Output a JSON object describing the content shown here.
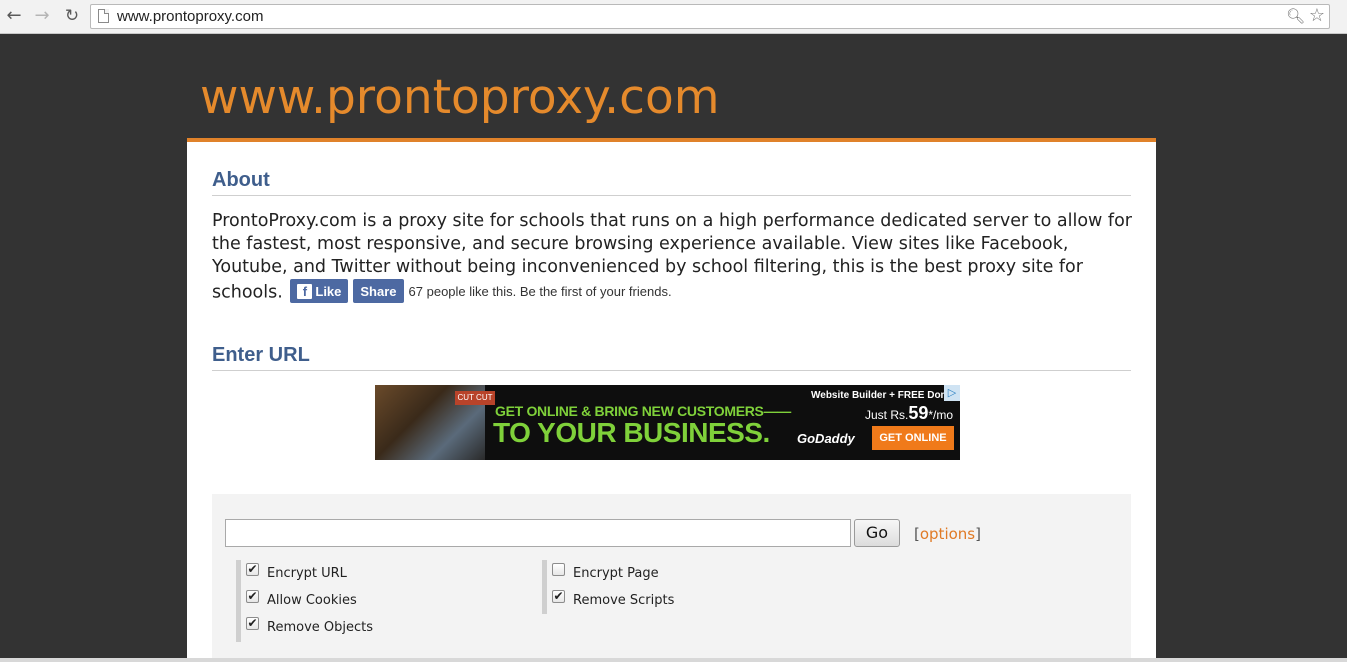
{
  "browser": {
    "back_icon": "←",
    "forward_icon": "→",
    "reload_icon": "↻",
    "address": "www.prontoproxy.com"
  },
  "site": {
    "title": "www.prontoproxy.com",
    "accent_color": "#e58a2c"
  },
  "about": {
    "heading": "About",
    "text": "ProntoProxy.com is a proxy site for schools that runs on a high performance dedicated server to allow for the fastest, most responsive, and secure browsing experience available. View sites like Facebook, Youtube, and Twitter without being inconvenienced by school filtering, this is the best proxy site for schools.",
    "facebook": {
      "like_label": "Like",
      "share_label": "Share",
      "count_text": "67 people like this. Be the first of your friends."
    }
  },
  "enter_url": {
    "heading": "Enter URL"
  },
  "ad": {
    "photo_sign": "CUT CUT",
    "line1": "GET ONLINE & BRING NEW CUSTOMERS——",
    "line2": "TO YOUR BUSINESS.",
    "promo": "Website Builder + FREE Dom",
    "price_prefix": "Just",
    "price_currency": "Rs.",
    "price_amount": "59",
    "price_suffix": "*/mo",
    "logo": "GoDaddy",
    "cta": "GET ONLINE",
    "adchoices_icon": "▷"
  },
  "form": {
    "url_value": "",
    "go_label": "Go",
    "options_open": "[",
    "options_label": "options",
    "options_close": "]",
    "checkboxes_left": [
      {
        "label": "Encrypt URL",
        "checked": true
      },
      {
        "label": "Allow Cookies",
        "checked": true
      },
      {
        "label": "Remove Objects",
        "checked": true
      }
    ],
    "checkboxes_right": [
      {
        "label": "Encrypt Page",
        "checked": false
      },
      {
        "label": "Remove Scripts",
        "checked": true
      }
    ]
  }
}
